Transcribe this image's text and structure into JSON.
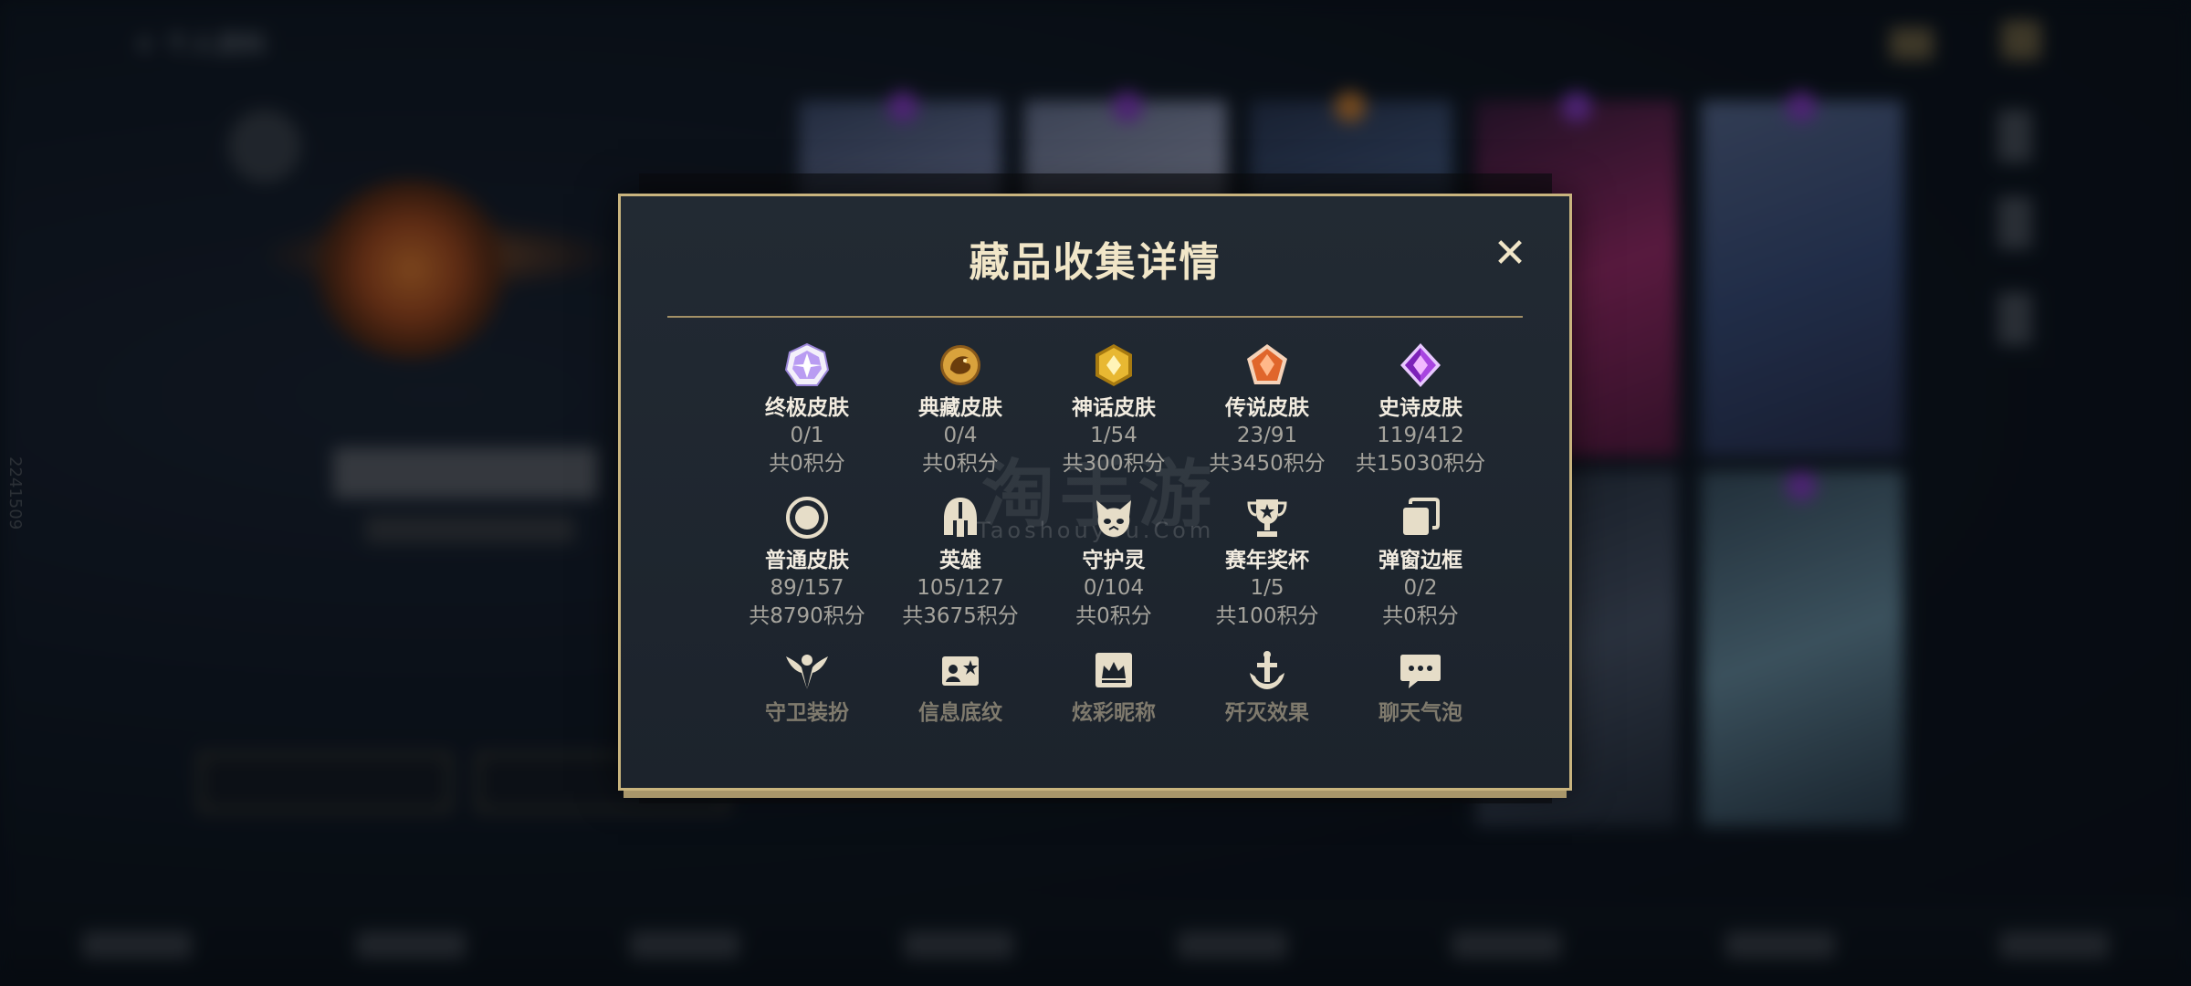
{
  "background": {
    "breadcrumb": "个人资料",
    "player_id": "2241509"
  },
  "dialog": {
    "title": "藏品收集详情",
    "close_glyph": "✕"
  },
  "watermark": {
    "cn": "淘手游",
    "en": "Taoshouyou.Com"
  },
  "collection": [
    {
      "label": "终极皮肤",
      "count": "0/1",
      "points": "共0积分",
      "icon": "ultimate-skin-icon",
      "color": "#b99cf2"
    },
    {
      "label": "典藏皮肤",
      "count": "0/4",
      "points": "共0积分",
      "icon": "collector-skin-icon",
      "color": "#d9a23c"
    },
    {
      "label": "神话皮肤",
      "count": "1/54",
      "points": "共300积分",
      "icon": "mythic-skin-icon",
      "color": "#e8b832"
    },
    {
      "label": "传说皮肤",
      "count": "23/91",
      "points": "共3450积分",
      "icon": "legend-skin-icon",
      "color": "#e0662c"
    },
    {
      "label": "史诗皮肤",
      "count": "119/412",
      "points": "共15030积分",
      "icon": "epic-skin-icon",
      "color": "#a845e0"
    },
    {
      "label": "普通皮肤",
      "count": "89/157",
      "points": "共8790积分",
      "icon": "normal-skin-icon",
      "color": "#e6ddc8"
    },
    {
      "label": "英雄",
      "count": "105/127",
      "points": "共3675积分",
      "icon": "hero-helmet-icon",
      "color": "#e6ddc8"
    },
    {
      "label": "守护灵",
      "count": "0/104",
      "points": "共0积分",
      "icon": "guardian-spirit-icon",
      "color": "#e6ddc8"
    },
    {
      "label": "赛年奖杯",
      "count": "1/5",
      "points": "共100积分",
      "icon": "trophy-icon",
      "color": "#e6ddc8"
    },
    {
      "label": "弹窗边框",
      "count": "0/2",
      "points": "共0积分",
      "icon": "popup-frame-icon",
      "color": "#e6ddc8"
    },
    {
      "label": "守卫装扮",
      "count": "",
      "points": "",
      "icon": "guard-outfit-icon",
      "color": "#e6ddc8"
    },
    {
      "label": "信息底纹",
      "count": "",
      "points": "",
      "icon": "info-background-icon",
      "color": "#e6ddc8"
    },
    {
      "label": "炫彩昵称",
      "count": "",
      "points": "",
      "icon": "colorful-nickname-icon",
      "color": "#e6ddc8"
    },
    {
      "label": "歼灭效果",
      "count": "",
      "points": "",
      "icon": "annihilation-effect-icon",
      "color": "#e6ddc8"
    },
    {
      "label": "聊天气泡",
      "count": "",
      "points": "",
      "icon": "chat-bubble-icon",
      "color": "#e6ddc8"
    }
  ]
}
